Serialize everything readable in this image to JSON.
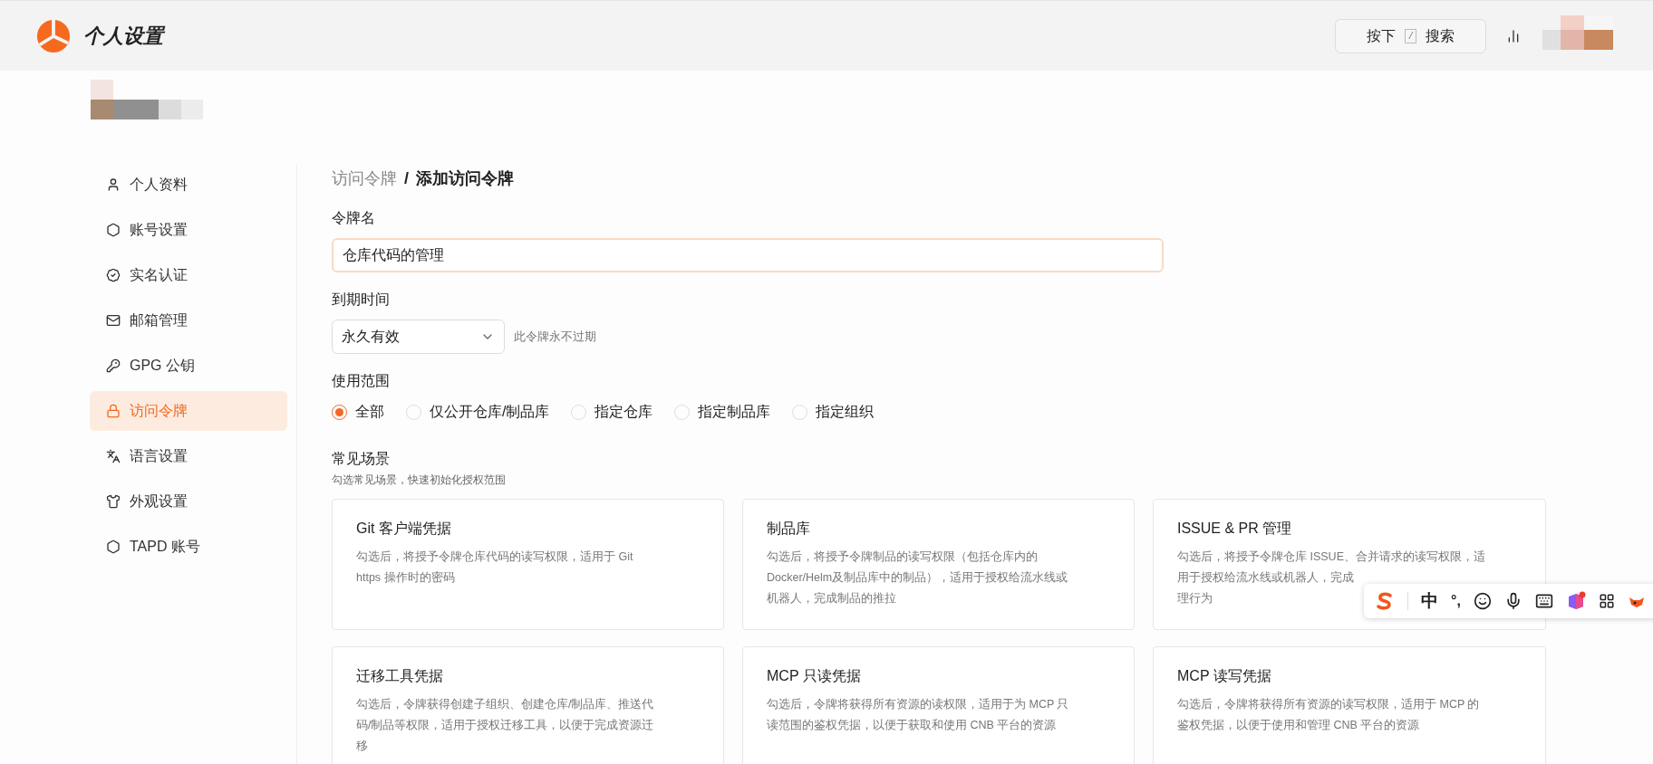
{
  "header": {
    "title": "个人设置",
    "search": {
      "before": "按下",
      "key": "/",
      "after": "搜索"
    }
  },
  "sidebar": {
    "items": [
      {
        "label": "个人资料",
        "selected": false
      },
      {
        "label": "账号设置",
        "selected": false
      },
      {
        "label": "实名认证",
        "selected": false
      },
      {
        "label": "邮箱管理",
        "selected": false
      },
      {
        "label": "GPG 公钥",
        "selected": false
      },
      {
        "label": "访问令牌",
        "selected": true
      },
      {
        "label": "语言设置",
        "selected": false
      },
      {
        "label": "外观设置",
        "selected": false
      },
      {
        "label": "TAPD 账号",
        "selected": false
      }
    ]
  },
  "breadcrumb": {
    "parent": "访问令牌",
    "separator": "/",
    "current": "添加访问令牌"
  },
  "form": {
    "name": {
      "label": "令牌名",
      "value": "仓库代码的管理"
    },
    "expiry": {
      "label": "到期时间",
      "value": "永久有效",
      "hint": "此令牌永不过期"
    },
    "scope": {
      "label": "使用范围",
      "options": [
        {
          "label": "全部",
          "selected": true
        },
        {
          "label": "仅公开仓库/制品库",
          "selected": false
        },
        {
          "label": "指定仓库",
          "selected": false
        },
        {
          "label": "指定制品库",
          "selected": false
        },
        {
          "label": "指定组织",
          "selected": false
        }
      ]
    },
    "scenarios": {
      "label": "常见场景",
      "hint": "勾选常见场景，快速初始化授权范围",
      "cards": [
        {
          "title": "Git 客户端凭据",
          "lines": [
            "勾选后，将授予令牌仓库代码的读写权限，适用于 Git",
            "https 操作时的密码"
          ]
        },
        {
          "title": "制品库",
          "lines": [
            "勾选后，将授予令牌制品的读写权限（包括仓库内的",
            "Docker/Helm及制品库中的制品），适用于授权给流水线或",
            "机器人，完成制品的推拉"
          ]
        },
        {
          "title": "ISSUE & PR 管理",
          "lines": [
            "勾选后，将授予令牌仓库 ISSUE、合并请求的读写权限，适",
            "用于授权给流水线或机器人，完成",
            "理行为"
          ]
        },
        {
          "title": "迁移工具凭据",
          "lines": [
            "勾选后，令牌获得创建子组织、创建仓库/制品库、推送代",
            "码/制品等权限，适用于授权迁移工具，以便于完成资源迁",
            "移"
          ]
        },
        {
          "title": "MCP 只读凭据",
          "lines": [
            "勾选后，令牌将获得所有资源的读权限，适用于为 MCP 只",
            "读范围的鉴权凭据，以便于获取和使用 CNB 平台的资源"
          ]
        },
        {
          "title": "MCP 读写凭据",
          "lines": [
            "勾选后，令牌将获得所有资源的读写权限，适用于 MCP 的",
            "鉴权凭据，以便于使用和管理 CNB 平台的资源"
          ]
        }
      ]
    }
  },
  "ime_toolbar": {
    "mode": "中",
    "punctuation": "°,"
  }
}
